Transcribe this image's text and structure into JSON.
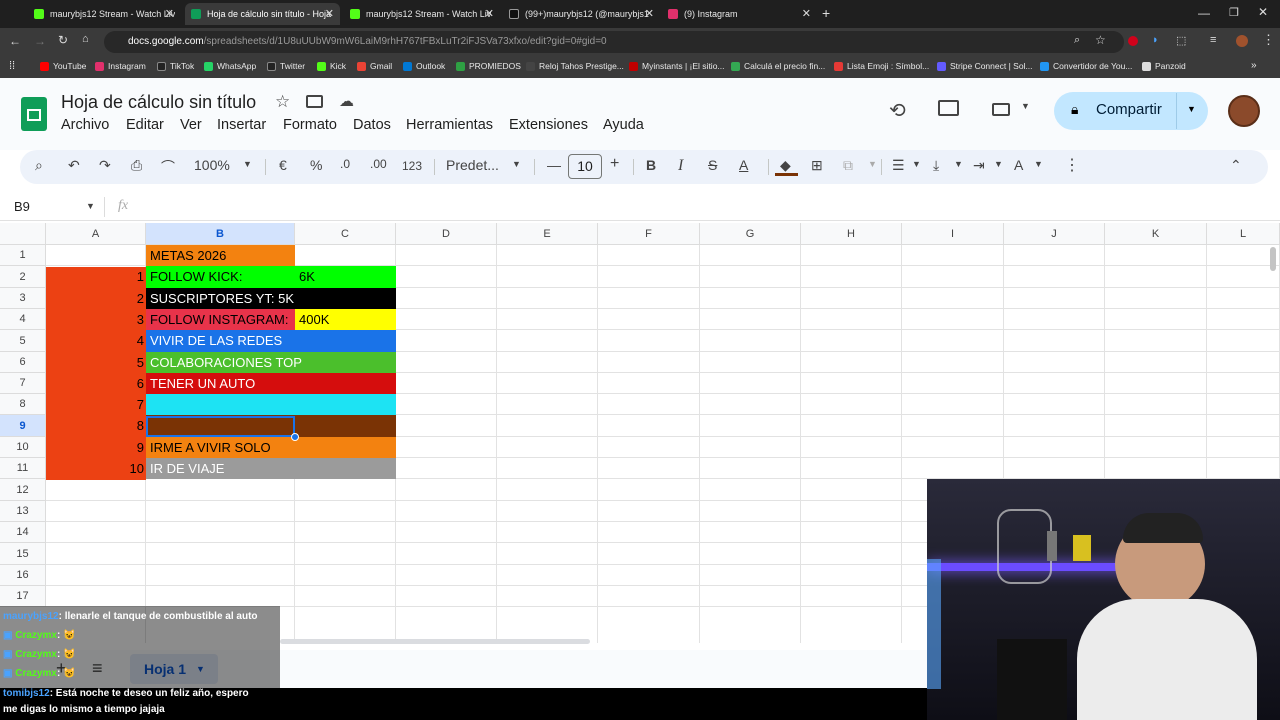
{
  "browser": {
    "tabs": [
      {
        "title": "maurybjs12 Stream - Watch Liv",
        "icon": "kick-icon",
        "color": "#53fc18"
      },
      {
        "title": "Hoja de cálculo sin título - Hoja",
        "icon": "sheets-icon",
        "color": "#0f9d58"
      },
      {
        "title": "maurybjs12 Stream - Watch Liv",
        "icon": "kick-icon",
        "color": "#53fc18"
      },
      {
        "title": "(99+)maurybjs12 (@maurybjs1",
        "icon": "tiktok-icon",
        "color": "#111111"
      },
      {
        "title": "(9) Instagram",
        "icon": "instagram-icon",
        "color": "#e1306c"
      }
    ],
    "url_host": "docs.google.com",
    "url_path": "/spreadsheets/d/1U8uUUbW9mW6LaiM9rhH767tFBxLuTr2iFJSVa73xfxo/edit?gid=0#gid=0",
    "bookmarks": [
      {
        "label": "YouTube",
        "color": "#ff0000"
      },
      {
        "label": "Instagram",
        "color": "#e1306c"
      },
      {
        "label": "TikTok",
        "color": "#222222"
      },
      {
        "label": "WhatsApp",
        "color": "#25d366"
      },
      {
        "label": "Twitter",
        "color": "#222222"
      },
      {
        "label": "Kick",
        "color": "#53fc18"
      },
      {
        "label": "Gmail",
        "color": "#ea4335"
      },
      {
        "label": "Outlook",
        "color": "#0078d4"
      },
      {
        "label": "PROMIEDOS",
        "color": "#2ea043"
      },
      {
        "label": "Reloj Tahos Prestige...",
        "color": "#444444"
      },
      {
        "label": "Myinstants | ¡El sitio...",
        "color": "#c00000"
      },
      {
        "label": "Calculá el precio fin...",
        "color": "#34a853"
      },
      {
        "label": "Lista Emoji : Símbol...",
        "color": "#e53935"
      },
      {
        "label": "Stripe Connect | Sol...",
        "color": "#635bff"
      },
      {
        "label": "Convertidor de You...",
        "color": "#2196f3"
      },
      {
        "label": "Panzoid",
        "color": "#dddddd"
      }
    ]
  },
  "app": {
    "title": "Hoja de cálculo sin título",
    "menu": [
      "Archivo",
      "Editar",
      "Ver",
      "Insertar",
      "Formato",
      "Datos",
      "Herramientas",
      "Extensiones",
      "Ayuda"
    ],
    "share_label": "Compartir",
    "zoom": "100%",
    "currency": "€",
    "percent": "%",
    "dec_less": ".0",
    "dec_more": ".00",
    "format_123": "123",
    "font": "Predet...",
    "font_size": "10",
    "cell_ref": "B9",
    "fx": "fx"
  },
  "grid": {
    "columns": [
      "A",
      "B",
      "C",
      "D",
      "E",
      "F",
      "G",
      "H",
      "I",
      "J",
      "K",
      "L"
    ],
    "rows": [
      "1",
      "2",
      "3",
      "4",
      "5",
      "6",
      "7",
      "8",
      "9",
      "10",
      "11",
      "12",
      "13",
      "14",
      "15",
      "16",
      "17"
    ],
    "title_cell": "METAS 2026",
    "numbers": [
      "1",
      "2",
      "3",
      "4",
      "5",
      "6",
      "7",
      "8",
      "9",
      "10"
    ],
    "goals": [
      {
        "text": "FOLLOW KICK:",
        "extra": "6K",
        "bg": "#00ff00",
        "fg": "#000000"
      },
      {
        "text": "SUSCRIPTORES YT: 5K",
        "extra": "",
        "bg": "#000000",
        "fg": "#ffffff"
      },
      {
        "text": "FOLLOW INSTAGRAM:",
        "extra": "400K",
        "bg": "#e8334a",
        "fg": "#000000"
      },
      {
        "text": "VIVIR DE LAS REDES",
        "extra": "",
        "bg": "#1a73e8",
        "fg": "#ffffff"
      },
      {
        "text": "COLABORACIONES TOP",
        "extra": "",
        "bg": "#4bbf2c",
        "fg": "#ffffff"
      },
      {
        "text": "TENER UN AUTO",
        "extra": "",
        "bg": "#d50d0d",
        "fg": "#ffffff"
      },
      {
        "text": "",
        "extra": "",
        "bg": "#1de3f3",
        "fg": "#000000"
      },
      {
        "text": "",
        "extra": "",
        "bg": "#7a3305",
        "fg": "#ffffff"
      },
      {
        "text": "IRME A VIVIR SOLO",
        "extra": "",
        "bg": "#f38210",
        "fg": "#000000"
      },
      {
        "text": "IR DE VIAJE",
        "extra": "",
        "bg": "#9b9b9b",
        "fg": "#ffffff"
      }
    ]
  },
  "sheet_tab": "Hoja 1",
  "chat": [
    {
      "user": "maurybjs12",
      "msg": ": llenarle el tanque de combustible al auto",
      "color": "#4aa3ff"
    },
    {
      "user": "Crazymx",
      "msg": ":",
      "color": "#53fc18"
    },
    {
      "user": "Crazymx",
      "msg": ":",
      "color": "#53fc18"
    },
    {
      "user": "Crazymx",
      "msg": ":",
      "color": "#53fc18"
    },
    {
      "user": "tomibjs12",
      "msg": ": Está noche te deseo un feliz año, espero",
      "color": "#4aa3ff"
    },
    {
      "user": "",
      "msg": "me digas lo mismo a tiempo jajaja",
      "color": "#ffffff"
    }
  ]
}
